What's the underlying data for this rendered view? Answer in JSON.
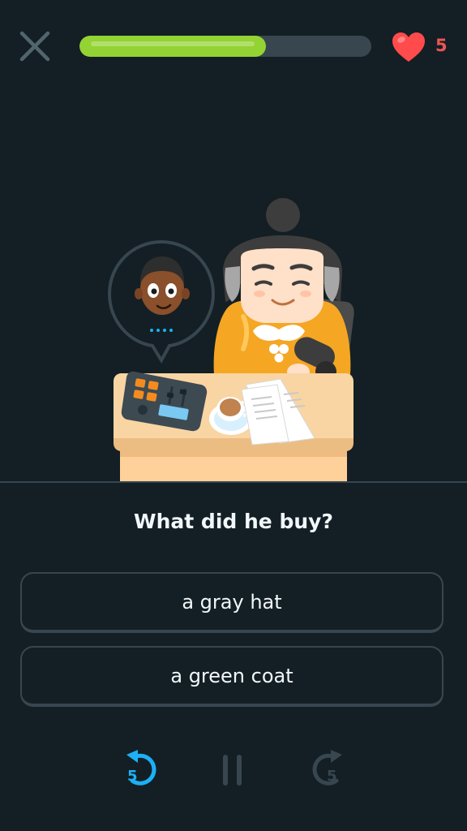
{
  "header": {
    "close_icon": "close-icon",
    "progress_fraction": 0.64,
    "hearts_count": "5",
    "heart_icon": "heart-icon"
  },
  "colors": {
    "background": "#131f24",
    "progress_fill": "#93d333",
    "progress_track": "#37464f",
    "heart": "#ff4b4b",
    "heart_count": "#ee5555",
    "rewind_active": "#1cb0f6",
    "inactive_control": "#37464f",
    "choice_border": "#37464f"
  },
  "question": {
    "text": "What did he buy?"
  },
  "choices": [
    {
      "label": "a gray hat"
    },
    {
      "label": "a green coat"
    }
  ],
  "controls": {
    "rewind": {
      "icon": "rewind-5-icon",
      "number": "5"
    },
    "pause": {
      "icon": "pause-icon"
    },
    "forward": {
      "icon": "forward-5-icon",
      "number": "5"
    }
  }
}
